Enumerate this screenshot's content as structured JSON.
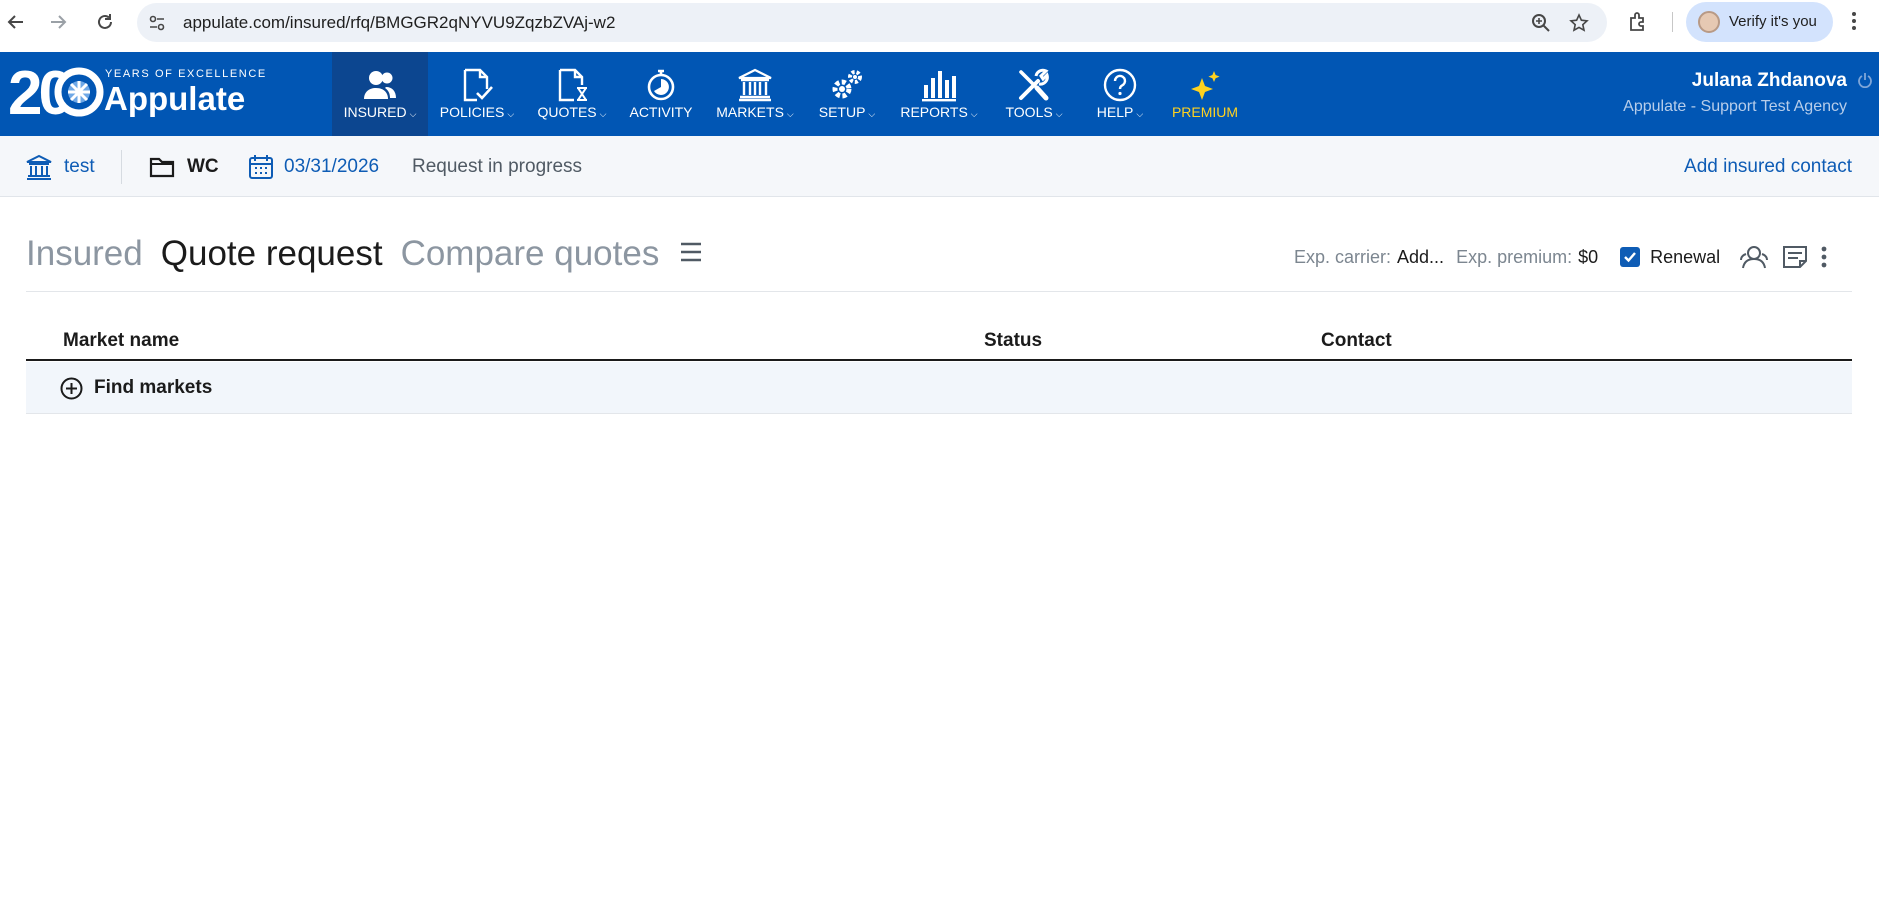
{
  "browser": {
    "url": "appulate.com/insured/rfq/BMGGR2qNYVU9ZqzbZVAj-w2",
    "profile_label": "Verify it's you"
  },
  "header": {
    "logo": {
      "number": "20",
      "tagline": "YEARS OF EXCELLENCE",
      "brand": "Appulate"
    },
    "nav": [
      {
        "label": "INSURED",
        "icon": "users-icon",
        "caret": true,
        "active": true
      },
      {
        "label": "POLICIES",
        "icon": "policy-document-icon",
        "caret": true
      },
      {
        "label": "QUOTES",
        "icon": "quote-document-icon",
        "caret": true
      },
      {
        "label": "ACTIVITY",
        "icon": "stopwatch-icon",
        "caret": false
      },
      {
        "label": "MARKETS",
        "icon": "bank-icon",
        "caret": true
      },
      {
        "label": "SETUP",
        "icon": "gears-icon",
        "caret": true
      },
      {
        "label": "REPORTS",
        "icon": "bar-chart-icon",
        "caret": true
      },
      {
        "label": "TOOLS",
        "icon": "tools-icon",
        "caret": true
      },
      {
        "label": "HELP",
        "icon": "question-icon",
        "caret": true
      },
      {
        "label": "PREMIUM",
        "icon": "sparkles-icon",
        "caret": false
      }
    ],
    "user_name": "Julana Zhdanova",
    "agency": "Appulate - Support Test Agency"
  },
  "subbar": {
    "insured": "test",
    "line": "WC",
    "date": "03/31/2026",
    "status": "Request in progress",
    "add_contact": "Add insured contact"
  },
  "tabs": {
    "insured": "Insured",
    "quote_request": "Quote request",
    "compare_quotes": "Compare quotes"
  },
  "info": {
    "exp_carrier_label": "Exp. carrier:",
    "exp_carrier_value": "Add...",
    "exp_premium_label": "Exp. premium:",
    "exp_premium_value": "$0",
    "renewal_label": "Renewal",
    "renewal_checked": true
  },
  "table": {
    "columns": [
      "Market name",
      "Status",
      "Contact"
    ],
    "find_markets": "Find markets"
  },
  "colors": {
    "brand_blue": "#0156b4",
    "active_nav": "#0c4690",
    "premium_yellow": "#ffd21f",
    "link_blue": "#0e5cb5"
  }
}
